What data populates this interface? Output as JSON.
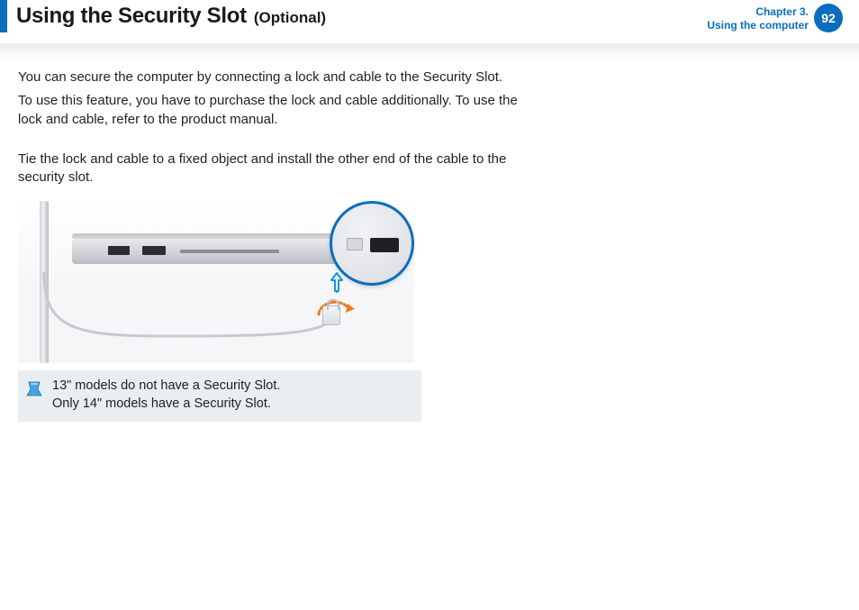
{
  "header": {
    "title_main": "Using the Security Slot",
    "title_sub": "(Optional)",
    "chapter_line1": "Chapter 3.",
    "chapter_line2": "Using the computer",
    "page_number": "92"
  },
  "body": {
    "p1": "You can secure the computer by connecting a lock and cable to the Security Slot.",
    "p2": "To use this feature, you have to purchase the lock and cable additionally. To use the lock and cable, refer to the product manual.",
    "p3": "Tie the lock and cable to a fixed object and install the other end of the cable to the security slot."
  },
  "note": {
    "line1": "13\" models do not have a Security Slot.",
    "line2": "Only 14\" models have a Security Slot."
  },
  "icons": {
    "note_icon": "note-pin-icon",
    "lock_icon": "lock-icon",
    "up_arrow_icon": "up-arrow-icon",
    "rotate_icon": "rotate-arrow-icon"
  }
}
